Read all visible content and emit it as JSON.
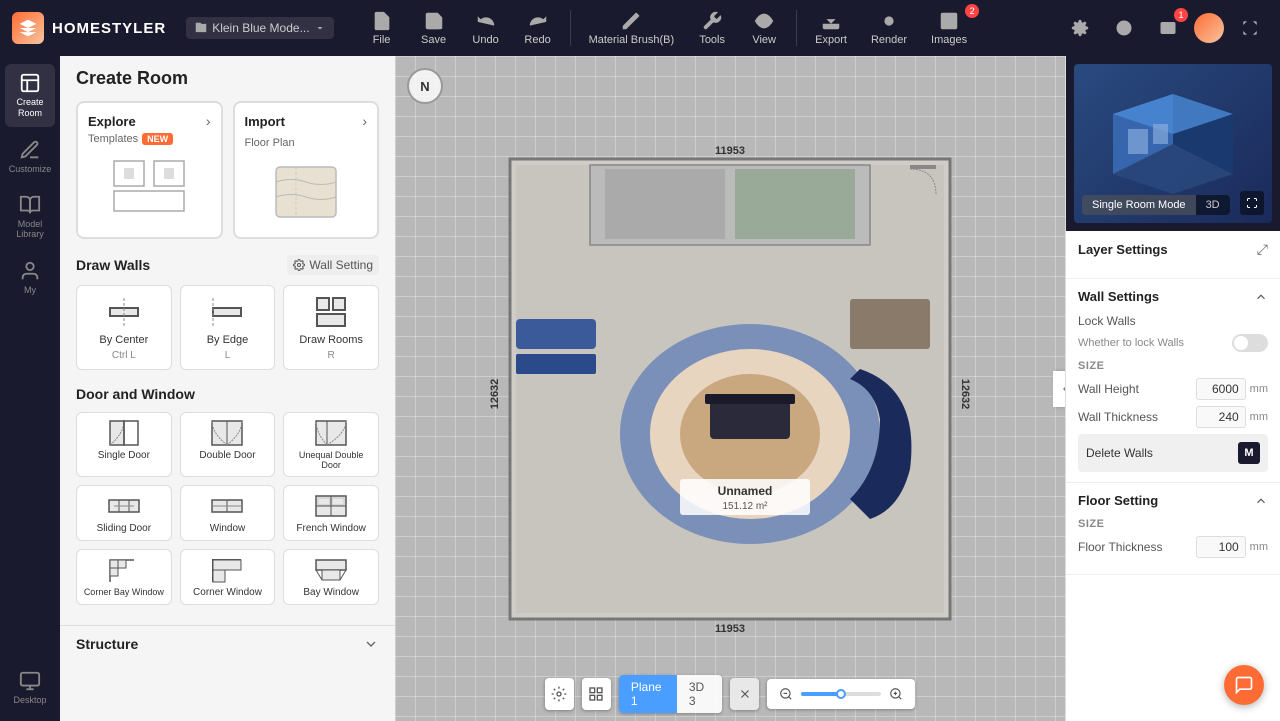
{
  "app": {
    "name": "HOMESTYLER",
    "project": "Klein Blue Mode..."
  },
  "topbar": {
    "file_label": "File",
    "save_label": "Save",
    "undo_label": "Undo",
    "redo_label": "Redo",
    "material_brush_label": "Material Brush(B)",
    "tools_label": "Tools",
    "view_label": "View",
    "export_label": "Export",
    "render_label": "Render",
    "images_label": "Images",
    "images_badge": "2"
  },
  "left_nav": {
    "items": [
      {
        "id": "create-room",
        "label": "Create\nRoom"
      },
      {
        "id": "customize",
        "label": "Customize"
      },
      {
        "id": "model-library",
        "label": "Model\nLibrary"
      },
      {
        "id": "my",
        "label": "My"
      }
    ]
  },
  "panel": {
    "title": "Create Room",
    "explore": {
      "title": "Explore",
      "subtitle": "Templates",
      "badge": "NEW",
      "arrow": "›"
    },
    "import": {
      "title": "Import",
      "subtitle": "Floor Plan",
      "arrow": "›"
    },
    "draw_walls": {
      "title": "Draw Walls",
      "wall_setting": "Wall Setting",
      "options": [
        {
          "id": "by-center",
          "label": "By Center",
          "shortcut": "Ctrl L"
        },
        {
          "id": "by-edge",
          "label": "By Edge",
          "shortcut": "L"
        },
        {
          "id": "draw-rooms",
          "label": "Draw Rooms",
          "shortcut": "R"
        }
      ]
    },
    "door_window": {
      "title": "Door and Window",
      "items": [
        {
          "id": "single-door",
          "label": "Single Door"
        },
        {
          "id": "double-door",
          "label": "Double Door"
        },
        {
          "id": "unequal-double-door",
          "label": "Unequal Double Door"
        },
        {
          "id": "sliding-door",
          "label": "Sliding Door"
        },
        {
          "id": "window",
          "label": "Window"
        },
        {
          "id": "french-window",
          "label": "French Window"
        },
        {
          "id": "corner-bay-window",
          "label": "Corner Bay Window"
        },
        {
          "id": "corner-window",
          "label": "Corner Window"
        },
        {
          "id": "bay-window",
          "label": "Bay Window"
        }
      ]
    },
    "structure": {
      "title": "Structure"
    }
  },
  "canvas": {
    "room_name": "Unnamed",
    "room_area": "151.12 m²",
    "dim_top": "11953",
    "dim_left": "12632",
    "dim_right": "12632",
    "dim_bottom": "11953",
    "plane_tab": "Plane 1",
    "view_3d": "3D 3"
  },
  "right_panel": {
    "mode": {
      "single_room": "Single Room Mode",
      "view_3d": "3D"
    },
    "layer_settings": {
      "title": "Layer Settings"
    },
    "wall_settings": {
      "title": "Wall Settings",
      "lock_walls_label": "Lock Walls",
      "lock_walls_desc": "Whether to lock Walls",
      "size_label": "Size",
      "wall_height_label": "Wall Height",
      "wall_height_value": "6000",
      "wall_height_unit": "mm",
      "wall_thickness_label": "Wall Thickness",
      "wall_thickness_value": "240",
      "wall_thickness_unit": "mm",
      "delete_walls_label": "Delete Walls"
    },
    "floor_settings": {
      "title": "Floor Setting",
      "size_label": "Size",
      "floor_thickness_label": "Floor Thickness",
      "floor_thickness_value": "100",
      "floor_thickness_unit": "mm"
    }
  }
}
